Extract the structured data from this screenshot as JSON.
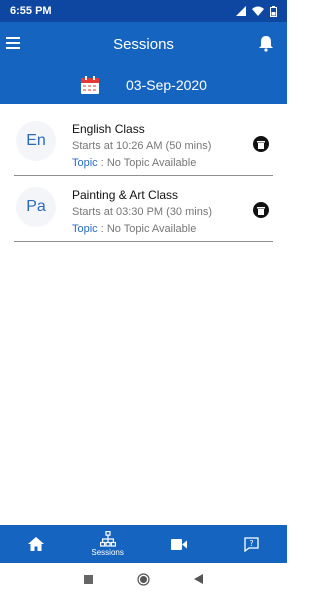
{
  "status_bar": {
    "time": "6:55 PM"
  },
  "header": {
    "title": "Sessions"
  },
  "date_bar": {
    "date": "03-Sep-2020"
  },
  "sessions": [
    {
      "initials": "En",
      "name": "English Class",
      "time": "Starts at 10:26 AM (50 mins)",
      "topic_label": "Topic",
      "topic_sep": " : ",
      "topic_value": "No Topic Available"
    },
    {
      "initials": "Pa",
      "name": "Painting & Art Class",
      "time": "Starts at 03:30 PM (30 mins)",
      "topic_label": "Topic",
      "topic_sep": " : ",
      "topic_value": "No Topic Available"
    }
  ],
  "bottom_nav": {
    "sessions_label": "Sessions"
  },
  "icons": [
    "menu-icon",
    "bell-icon",
    "calendar-icon",
    "delete-icon",
    "home-icon",
    "sessions-icon",
    "video-icon",
    "help-icon",
    "stop-icon",
    "record-icon",
    "back-icon"
  ],
  "colors": {
    "primary": "#1565c0",
    "status": "#0d47a1",
    "accent": "#2a6bbf"
  }
}
